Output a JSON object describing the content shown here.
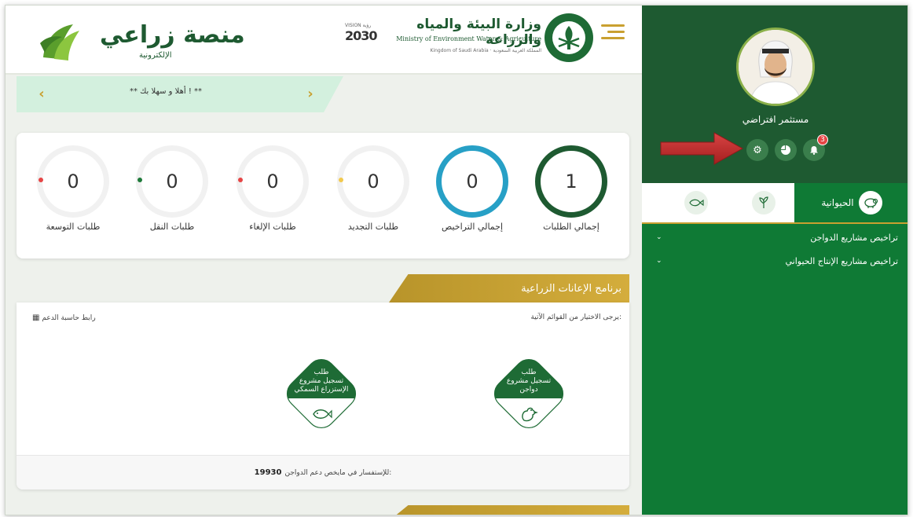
{
  "header": {
    "ministry_ar": "وزارة البيئة والمياه والزراعة",
    "ministry_en": "Ministry of Environment Water & Agriculture",
    "ministry_sub": "Kingdom of Saudi Arabia · المملكة العربية السعودية",
    "vision_small": "VISION رؤية",
    "vision_big": "2030",
    "brand_name": "منصة زراعي",
    "brand_sub": "الإلكترونية"
  },
  "welcome": {
    "text": "** أهلا و سهلا بك ! **"
  },
  "stats": [
    {
      "label": "إجمالي الطلبات",
      "value": "1",
      "style": "total",
      "dot": ""
    },
    {
      "label": "إجمالي التراخيص",
      "value": "0",
      "style": "licenses",
      "dot": ""
    },
    {
      "label": "طلبات التجديد",
      "value": "0",
      "style": "",
      "dot": "#f2c94c"
    },
    {
      "label": "طلبات الإلغاء",
      "value": "0",
      "style": "",
      "dot": "#e64545"
    },
    {
      "label": "طلبات النقل",
      "value": "0",
      "style": "",
      "dot": "#1e7a3a"
    },
    {
      "label": "طلبات التوسعة",
      "value": "0",
      "style": "",
      "dot": "#e64545"
    }
  ],
  "programs": {
    "title": "برنامج الإعانات الزراعية",
    "hint": "يرجى الاختيار من القوائم الآتية:",
    "calc_link": "رابط حاسبة الدعم",
    "poultry": {
      "line1": "طلب",
      "line2": "تسجيل مشروع",
      "line3": "دواجن"
    },
    "fish": {
      "line1": "طلب",
      "line2": "تسجيل مشروع",
      "line3": "الإستزراع السمكي"
    },
    "footer_text": "للإستفسار في مايخص دعم الدواجن:",
    "footer_number": "19930"
  },
  "sidebar": {
    "username": "مستثمر افتراضي",
    "notification_count": "3",
    "active_tab": "الحيوانية",
    "menu": [
      "تراخيص مشاريع الدواجن",
      "تراخيص مشاريع الإنتاج الحيواني"
    ]
  },
  "colors": {
    "sidebar_green": "#0f7a35",
    "profile_green": "#1e5a31",
    "gold": "#c9a030",
    "annotation_red": "#c62828"
  }
}
